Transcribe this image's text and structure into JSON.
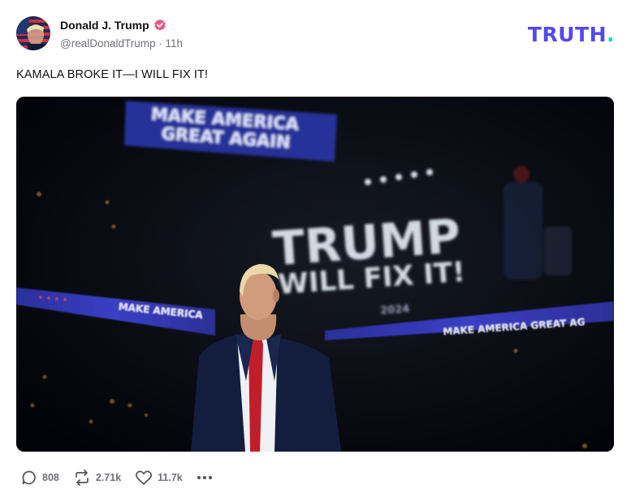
{
  "author": {
    "name": "Donald J. Trump",
    "handle": "@realDonaldTrump",
    "separator": "·",
    "time": "11h",
    "verified_icon": "verified-badge-icon",
    "verified_color": "#e95a7f"
  },
  "brand": {
    "text": "TRUTH",
    "dot": ".",
    "color": "#5448ee",
    "dot_color": "#12d8b5"
  },
  "post": {
    "text": "KAMALA BROKE IT—I WILL FIX IT!"
  },
  "media": {
    "signs": {
      "top_line1": "MAKE AMERICA",
      "top_line2": "GREAT AGAIN",
      "screen_line1": "TRUMP",
      "screen_line2": "WILL FIX IT!",
      "ribbon_left": "MAKE AMERICA",
      "ribbon_right": "MAKE AMERICA GREAT AG",
      "year": "2024"
    }
  },
  "actions": {
    "reply_count": "808",
    "repost_count": "2.71k",
    "like_count": "11.7k",
    "reply_icon": "reply-icon",
    "repost_icon": "repost-icon",
    "like_icon": "heart-icon",
    "more_icon": "more-icon"
  }
}
